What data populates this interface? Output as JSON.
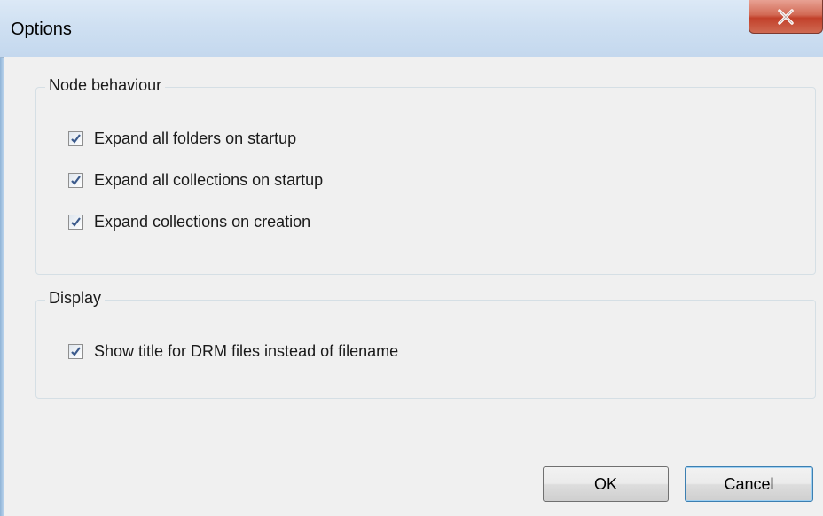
{
  "window": {
    "title": "Options",
    "close_glyph": "X"
  },
  "groups": {
    "node_behaviour": {
      "label": "Node behaviour",
      "items": [
        {
          "label": "Expand all folders on startup",
          "checked": true
        },
        {
          "label": "Expand all collections on startup",
          "checked": true
        },
        {
          "label": "Expand collections on creation",
          "checked": true
        }
      ]
    },
    "display": {
      "label": "Display",
      "items": [
        {
          "label": "Show title for DRM files instead of filename",
          "checked": true
        }
      ]
    }
  },
  "buttons": {
    "ok": "OK",
    "cancel": "Cancel"
  },
  "colors": {
    "accent": "#3c7fb1",
    "close_red": "#c2402a",
    "check_mark": "#3b5a8c"
  },
  "icons": {
    "close": "close-icon",
    "check": "checkmark-icon"
  }
}
